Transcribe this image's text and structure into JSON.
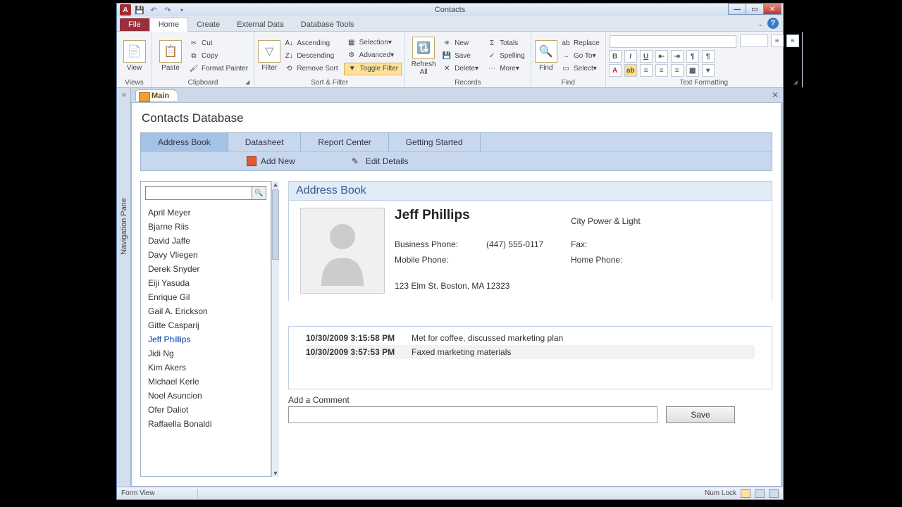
{
  "window": {
    "title": "Contacts"
  },
  "menu": {
    "file": "File",
    "tabs": [
      "Home",
      "Create",
      "External Data",
      "Database Tools"
    ],
    "active": "Home"
  },
  "ribbon": {
    "views": {
      "label": "Views",
      "view": "View"
    },
    "clipboard": {
      "label": "Clipboard",
      "paste": "Paste",
      "cut": "Cut",
      "copy": "Copy",
      "format_painter": "Format Painter"
    },
    "sort_filter": {
      "label": "Sort & Filter",
      "filter": "Filter",
      "ascending": "Ascending",
      "descending": "Descending",
      "remove_sort": "Remove Sort",
      "selection": "Selection",
      "advanced": "Advanced",
      "toggle_filter": "Toggle Filter"
    },
    "records": {
      "label": "Records",
      "refresh": "Refresh All",
      "new": "New",
      "save": "Save",
      "delete": "Delete",
      "totals": "Totals",
      "spelling": "Spelling",
      "more": "More"
    },
    "find": {
      "label": "Find",
      "find": "Find",
      "replace": "Replace",
      "goto": "Go To",
      "select": "Select"
    },
    "text": {
      "label": "Text Formatting"
    }
  },
  "nav": {
    "pane_label": "Navigation Pane"
  },
  "tab": {
    "main": "Main"
  },
  "form": {
    "title": "Contacts Database",
    "tabs": {
      "address_book": "Address Book",
      "datasheet": "Datasheet",
      "report_center": "Report Center",
      "getting_started": "Getting Started"
    },
    "actions": {
      "add_new": "Add New",
      "edit_details": "Edit Details"
    }
  },
  "contacts": {
    "search_placeholder": "",
    "list": [
      "April Meyer",
      "Bjarne Riis",
      "David Jaffe",
      "Davy Vliegen",
      "Derek Snyder",
      "Eiji Yasuda",
      "Enrique Gil",
      "Gail A. Erickson",
      "Gitte Casparij",
      "Jeff Phillips",
      "Jidi Ng",
      "Kim Akers",
      "Michael Kerle",
      "Noel Asuncion",
      "Ofer Daliot",
      "Raffaella Bonaldi"
    ],
    "selected_index": 9
  },
  "detail": {
    "header": "Address Book",
    "name": "Jeff Phillips",
    "company": "City Power & Light",
    "labels": {
      "business": "Business Phone:",
      "mobile": "Mobile Phone:",
      "fax": "Fax:",
      "home": "Home Phone:"
    },
    "business_phone": "(447) 555-0117",
    "mobile_phone": "",
    "fax": "",
    "home_phone": "",
    "address": "123 Elm St. Boston, MA 12323",
    "comments": [
      {
        "ts": "10/30/2009 3:15:58 PM",
        "text": "Met for coffee, discussed marketing plan"
      },
      {
        "ts": "10/30/2009 3:57:53 PM",
        "text": "Faxed marketing materials"
      }
    ],
    "add_label": "Add a Comment",
    "save": "Save"
  },
  "status": {
    "view": "Form View",
    "numlock": "Num Lock"
  }
}
